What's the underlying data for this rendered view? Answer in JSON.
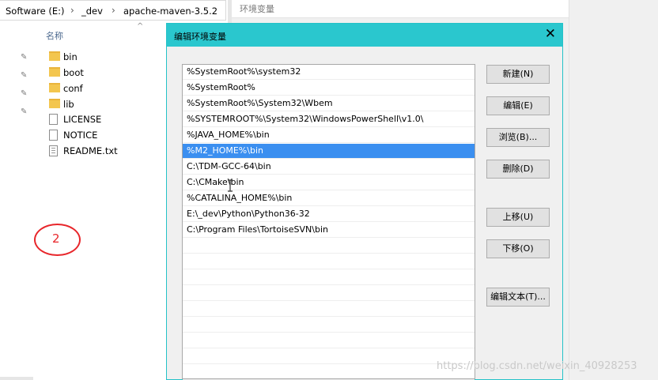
{
  "explorer": {
    "breadcrumb": [
      "Software (E:)",
      "_dev",
      "apache-maven-3.5.2"
    ],
    "column_header": "名称",
    "files": [
      {
        "name": "bin",
        "type": "folder"
      },
      {
        "name": "boot",
        "type": "folder"
      },
      {
        "name": "conf",
        "type": "folder"
      },
      {
        "name": "lib",
        "type": "folder"
      },
      {
        "name": "LICENSE",
        "type": "file"
      },
      {
        "name": "NOTICE",
        "type": "file"
      },
      {
        "name": "README.txt",
        "type": "text-file"
      }
    ]
  },
  "background_window": {
    "title": "环境变量"
  },
  "dialog": {
    "title": "编辑环境变量",
    "close_icon": "close-icon",
    "paths": [
      "%SystemRoot%\\system32",
      "%SystemRoot%",
      "%SystemRoot%\\System32\\Wbem",
      "%SYSTEMROOT%\\System32\\WindowsPowerShell\\v1.0\\",
      "%JAVA_HOME%\\bin",
      "%M2_HOME%\\bin",
      "C:\\TDM-GCC-64\\bin",
      "C:\\CMake\\bin",
      "%CATALINA_HOME%\\bin",
      "E:\\_dev\\Python\\Python36-32",
      "C:\\Program Files\\TortoiseSVN\\bin"
    ],
    "selected_index": 5,
    "buttons": {
      "new": "新建(N)",
      "edit": "编辑(E)",
      "browse": "浏览(B)...",
      "delete": "删除(D)",
      "move_up": "上移(U)",
      "move_down": "下移(O)",
      "edit_text": "编辑文本(T)..."
    }
  },
  "annotation": {
    "label": "2",
    "color": "#e8262b"
  },
  "watermark": "https://blog.csdn.net/weixin_40928253",
  "colors": {
    "title_bar": "#2ac7ce",
    "selection": "#3b8ff0",
    "folder": "#f3c64f"
  }
}
